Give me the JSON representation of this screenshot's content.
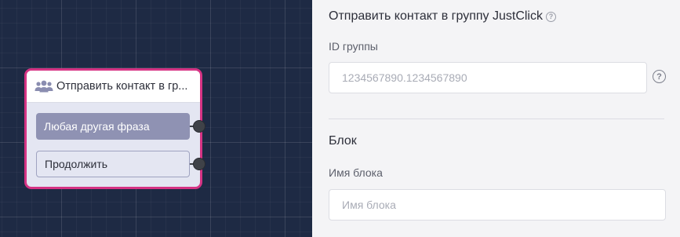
{
  "canvas": {
    "node": {
      "title": "Отправить контакт в гр...",
      "icon": "users-group-icon",
      "buttons": [
        {
          "label": "Любая другая фраза"
        },
        {
          "label": "Продолжить"
        }
      ],
      "border_color": "#d63384"
    }
  },
  "panel": {
    "title": "Отправить контакт в группу JustClick",
    "help_symbol": "?",
    "group_id": {
      "label": "ID группы",
      "placeholder": "1234567890.1234567890",
      "help_symbol": "?"
    },
    "block_section": {
      "title": "Блок",
      "name_label": "Имя блока",
      "name_placeholder": "Имя блока"
    }
  }
}
